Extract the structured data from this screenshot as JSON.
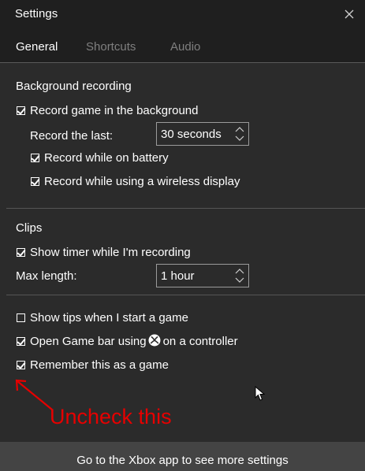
{
  "window": {
    "title": "Settings"
  },
  "tabs": [
    {
      "label": "General",
      "active": true
    },
    {
      "label": "Shortcuts",
      "active": false
    },
    {
      "label": "Audio",
      "active": false
    }
  ],
  "background_recording": {
    "title": "Background recording",
    "record_in_background": {
      "label": "Record game in the background",
      "checked": true
    },
    "record_the_last": {
      "label": "Record the last:",
      "value": "30 seconds"
    },
    "record_on_battery": {
      "label": "Record while on battery",
      "checked": true
    },
    "record_wireless_display": {
      "label": "Record while using a wireless display",
      "checked": true
    }
  },
  "clips": {
    "title": "Clips",
    "show_timer": {
      "label": "Show timer while I'm recording",
      "checked": true
    },
    "max_length": {
      "label": "Max length:",
      "value": "1 hour"
    }
  },
  "misc": {
    "show_tips": {
      "label": "Show tips when I start a game",
      "checked": false
    },
    "open_game_bar_pre": "Open Game bar using",
    "open_game_bar_post": "on a controller",
    "open_game_bar_checked": true,
    "remember_game": {
      "label": "Remember this as a game",
      "checked": true
    }
  },
  "footer": {
    "label": "Go to the Xbox app to see more settings"
  },
  "annotation": {
    "text": "Uncheck this",
    "color": "#e60000"
  },
  "colors": {
    "background": "#2b2b2b",
    "titlebar": "#1f1f1f",
    "footer": "#444444",
    "inactive_tab": "#7f7f7f"
  }
}
